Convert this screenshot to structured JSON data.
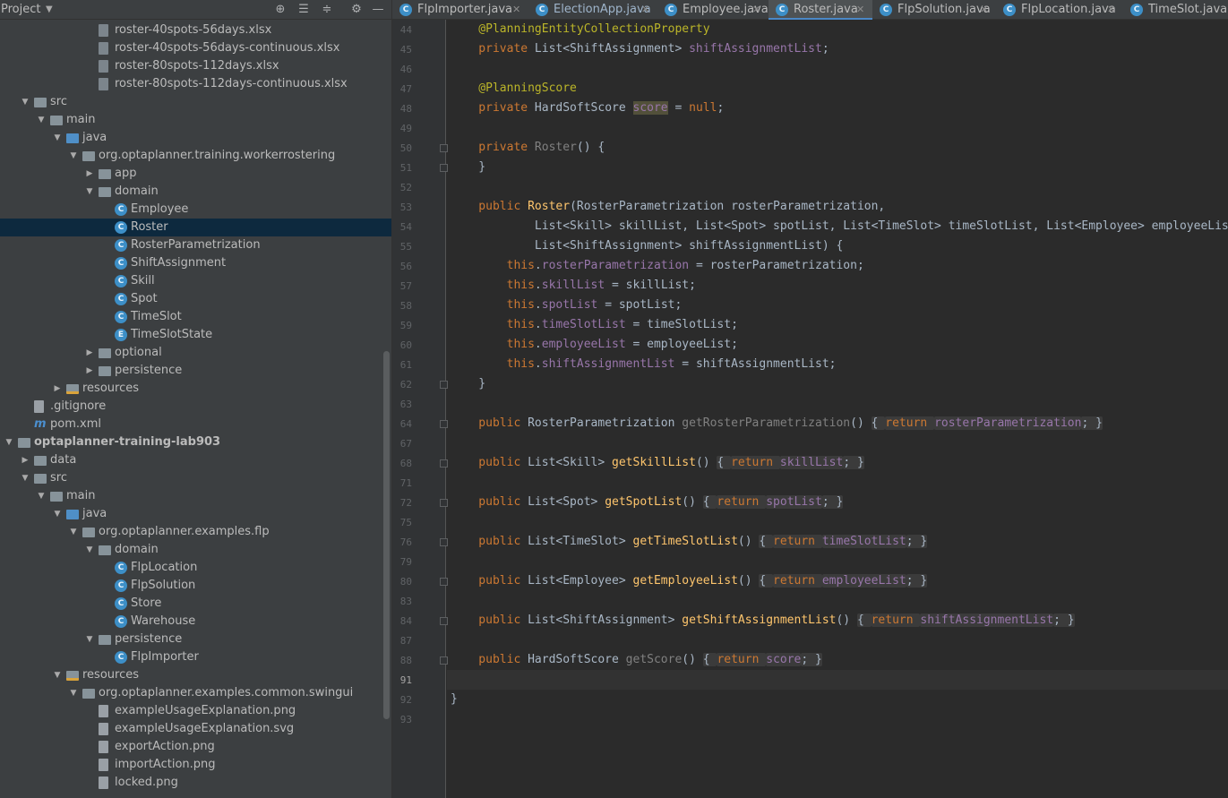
{
  "project_panel": {
    "title": "Project",
    "toolbar_icons": [
      "locate-icon",
      "expand-all-icon",
      "collapse-all-icon",
      "settings-icon",
      "hide-icon"
    ]
  },
  "tree": [
    {
      "label": "roster-40spots-56days.xlsx",
      "icon": "xlsx-file-icon",
      "depth": 5,
      "arrow": ""
    },
    {
      "label": "roster-40spots-56days-continuous.xlsx",
      "icon": "xlsx-file-icon",
      "depth": 5,
      "arrow": ""
    },
    {
      "label": "roster-80spots-112days.xlsx",
      "icon": "xlsx-file-icon",
      "depth": 5,
      "arrow": ""
    },
    {
      "label": "roster-80spots-112days-continuous.xlsx",
      "icon": "xlsx-file-icon",
      "depth": 5,
      "arrow": ""
    },
    {
      "label": "src",
      "icon": "folder-icon",
      "depth": 1,
      "arrow": "down"
    },
    {
      "label": "main",
      "icon": "folder-icon",
      "depth": 2,
      "arrow": "down"
    },
    {
      "label": "java",
      "icon": "source-folder-icon",
      "depth": 3,
      "arrow": "down"
    },
    {
      "label": "org.optaplanner.training.workerrostering",
      "icon": "package-icon",
      "depth": 4,
      "arrow": "down"
    },
    {
      "label": "app",
      "icon": "package-icon",
      "depth": 5,
      "arrow": "right"
    },
    {
      "label": "domain",
      "icon": "package-icon",
      "depth": 5,
      "arrow": "down"
    },
    {
      "label": "Employee",
      "icon": "class-icon",
      "depth": 6,
      "arrow": ""
    },
    {
      "label": "Roster",
      "icon": "class-icon",
      "depth": 6,
      "arrow": "",
      "selected": true
    },
    {
      "label": "RosterParametrization",
      "icon": "class-icon",
      "depth": 6,
      "arrow": ""
    },
    {
      "label": "ShiftAssignment",
      "icon": "class-icon",
      "depth": 6,
      "arrow": ""
    },
    {
      "label": "Skill",
      "icon": "class-icon",
      "depth": 6,
      "arrow": ""
    },
    {
      "label": "Spot",
      "icon": "class-icon",
      "depth": 6,
      "arrow": ""
    },
    {
      "label": "TimeSlot",
      "icon": "class-icon",
      "depth": 6,
      "arrow": ""
    },
    {
      "label": "TimeSlotState",
      "icon": "enum-icon",
      "depth": 6,
      "arrow": ""
    },
    {
      "label": "optional",
      "icon": "package-icon",
      "depth": 5,
      "arrow": "right"
    },
    {
      "label": "persistence",
      "icon": "package-icon",
      "depth": 5,
      "arrow": "right"
    },
    {
      "label": "resources",
      "icon": "resources-folder-icon",
      "depth": 3,
      "arrow": "right"
    },
    {
      "label": ".gitignore",
      "icon": "gitignore-file-icon",
      "depth": 1,
      "arrow": ""
    },
    {
      "label": "pom.xml",
      "icon": "maven-icon",
      "depth": 1,
      "arrow": ""
    },
    {
      "label": "optaplanner-training-lab903",
      "icon": "module-icon",
      "depth": 0,
      "arrow": "down",
      "bold": true
    },
    {
      "label": "data",
      "icon": "folder-icon",
      "depth": 1,
      "arrow": "right"
    },
    {
      "label": "src",
      "icon": "folder-icon",
      "depth": 1,
      "arrow": "down"
    },
    {
      "label": "main",
      "icon": "folder-icon",
      "depth": 2,
      "arrow": "down"
    },
    {
      "label": "java",
      "icon": "source-folder-icon",
      "depth": 3,
      "arrow": "down"
    },
    {
      "label": "org.optaplanner.examples.flp",
      "icon": "package-icon",
      "depth": 4,
      "arrow": "down"
    },
    {
      "label": "domain",
      "icon": "package-icon",
      "depth": 5,
      "arrow": "down"
    },
    {
      "label": "FlpLocation",
      "icon": "class-icon",
      "depth": 6,
      "arrow": ""
    },
    {
      "label": "FlpSolution",
      "icon": "class-icon",
      "depth": 6,
      "arrow": ""
    },
    {
      "label": "Store",
      "icon": "class-icon",
      "depth": 6,
      "arrow": ""
    },
    {
      "label": "Warehouse",
      "icon": "class-icon",
      "depth": 6,
      "arrow": ""
    },
    {
      "label": "persistence",
      "icon": "package-icon",
      "depth": 5,
      "arrow": "down"
    },
    {
      "label": "FlpImporter",
      "icon": "class-icon",
      "depth": 6,
      "arrow": ""
    },
    {
      "label": "resources",
      "icon": "resources-folder-icon",
      "depth": 3,
      "arrow": "down"
    },
    {
      "label": "org.optaplanner.examples.common.swingui",
      "icon": "package-icon",
      "depth": 4,
      "arrow": "down"
    },
    {
      "label": "exampleUsageExplanation.png",
      "icon": "image-file-icon",
      "depth": 5,
      "arrow": ""
    },
    {
      "label": "exampleUsageExplanation.svg",
      "icon": "image-file-icon",
      "depth": 5,
      "arrow": ""
    },
    {
      "label": "exportAction.png",
      "icon": "image-file-icon",
      "depth": 5,
      "arrow": ""
    },
    {
      "label": "importAction.png",
      "icon": "image-file-icon",
      "depth": 5,
      "arrow": ""
    },
    {
      "label": "locked.png",
      "icon": "image-file-icon",
      "depth": 5,
      "arrow": ""
    }
  ],
  "tabs": [
    {
      "label": "FlpImporter.java",
      "active": false,
      "main": false
    },
    {
      "label": "ElectionApp.java",
      "active": false,
      "main": true
    },
    {
      "label": "Employee.java",
      "active": false,
      "main": false
    },
    {
      "label": "Roster.java",
      "active": true,
      "main": false
    },
    {
      "label": "FlpSolution.java",
      "active": false,
      "main": false
    },
    {
      "label": "FlpLocation.java",
      "active": false,
      "main": false
    },
    {
      "label": "TimeSlot.java",
      "active": false,
      "main": false
    }
  ],
  "editor": {
    "current_line": "91",
    "lines": [
      {
        "n": "44",
        "fold": false,
        "tokens": [
          [
            "an",
            "    @PlanningEntityCollectionProperty"
          ]
        ]
      },
      {
        "n": "45",
        "fold": false,
        "tokens": [
          [
            "kw",
            "    private "
          ],
          [
            "",
            "List<ShiftAssignment> "
          ],
          [
            "fd",
            "shiftAssignmentList"
          ],
          [
            "",
            ";"
          ]
        ]
      },
      {
        "n": "46",
        "fold": false,
        "tokens": []
      },
      {
        "n": "47",
        "fold": false,
        "tokens": [
          [
            "an",
            "    @PlanningScore"
          ]
        ]
      },
      {
        "n": "48",
        "fold": false,
        "tokens": [
          [
            "kw",
            "    private "
          ],
          [
            "",
            "HardSoftScore "
          ],
          [
            "fd hl",
            "score"
          ],
          [
            "",
            " = "
          ],
          [
            "kw",
            "null"
          ],
          [
            "",
            ";"
          ]
        ]
      },
      {
        "n": "49",
        "fold": false,
        "tokens": []
      },
      {
        "n": "50",
        "fold": true,
        "tokens": [
          [
            "kw",
            "    private "
          ],
          [
            "gr",
            "Roster"
          ],
          [
            "",
            "() {"
          ]
        ]
      },
      {
        "n": "51",
        "fold": true,
        "tokens": [
          [
            "",
            "    }"
          ]
        ]
      },
      {
        "n": "52",
        "fold": false,
        "tokens": []
      },
      {
        "n": "53",
        "fold": false,
        "tokens": [
          [
            "kw",
            "    public "
          ],
          [
            "mt",
            "Roster"
          ],
          [
            "",
            "(RosterParametrization rosterParametrization,"
          ]
        ]
      },
      {
        "n": "54",
        "fold": false,
        "tokens": [
          [
            "",
            "            List<Skill> skillList, List<Spot> spotList, List<TimeSlot> timeSlotList, List<Employee> employeeList,"
          ]
        ]
      },
      {
        "n": "55",
        "fold": false,
        "tokens": [
          [
            "",
            "            List<ShiftAssignment> shiftAssignmentList) {"
          ]
        ]
      },
      {
        "n": "56",
        "fold": false,
        "tokens": [
          [
            "kw",
            "        this"
          ],
          [
            "",
            "."
          ],
          [
            "fd",
            "rosterParametrization"
          ],
          [
            "",
            " = rosterParametrization;"
          ]
        ]
      },
      {
        "n": "57",
        "fold": false,
        "tokens": [
          [
            "kw",
            "        this"
          ],
          [
            "",
            "."
          ],
          [
            "fd",
            "skillList"
          ],
          [
            "",
            " = skillList;"
          ]
        ]
      },
      {
        "n": "58",
        "fold": false,
        "tokens": [
          [
            "kw",
            "        this"
          ],
          [
            "",
            "."
          ],
          [
            "fd",
            "spotList"
          ],
          [
            "",
            " = spotList;"
          ]
        ]
      },
      {
        "n": "59",
        "fold": false,
        "tokens": [
          [
            "kw",
            "        this"
          ],
          [
            "",
            "."
          ],
          [
            "fd",
            "timeSlotList"
          ],
          [
            "",
            " = timeSlotList;"
          ]
        ]
      },
      {
        "n": "60",
        "fold": false,
        "tokens": [
          [
            "kw",
            "        this"
          ],
          [
            "",
            "."
          ],
          [
            "fd",
            "employeeList"
          ],
          [
            "",
            " = employeeList;"
          ]
        ]
      },
      {
        "n": "61",
        "fold": false,
        "tokens": [
          [
            "kw",
            "        this"
          ],
          [
            "",
            "."
          ],
          [
            "fd",
            "shiftAssignmentList"
          ],
          [
            "",
            " = shiftAssignmentList;"
          ]
        ]
      },
      {
        "n": "62",
        "fold": true,
        "tokens": [
          [
            "",
            "    }"
          ]
        ]
      },
      {
        "n": "63",
        "fold": false,
        "tokens": []
      },
      {
        "n": "64",
        "fold": true,
        "tokens": [
          [
            "kw",
            "    public "
          ],
          [
            "",
            "RosterParametrization "
          ],
          [
            "gr",
            "getRosterParametrization"
          ],
          [
            "",
            "() "
          ],
          [
            "inlay",
            "{ "
          ],
          [
            "kw inlay",
            "return "
          ],
          [
            "fd inlay",
            "rosterParametrization"
          ],
          [
            "inlay",
            "; }"
          ]
        ]
      },
      {
        "n": "67",
        "fold": false,
        "tokens": []
      },
      {
        "n": "68",
        "fold": true,
        "tokens": [
          [
            "kw",
            "    public "
          ],
          [
            "",
            "List<Skill> "
          ],
          [
            "mt",
            "getSkillList"
          ],
          [
            "",
            "() "
          ],
          [
            "inlay",
            "{ "
          ],
          [
            "kw inlay",
            "return "
          ],
          [
            "fd inlay",
            "skillList"
          ],
          [
            "inlay",
            "; }"
          ]
        ]
      },
      {
        "n": "71",
        "fold": false,
        "tokens": []
      },
      {
        "n": "72",
        "fold": true,
        "tokens": [
          [
            "kw",
            "    public "
          ],
          [
            "",
            "List<Spot> "
          ],
          [
            "mt",
            "getSpotList"
          ],
          [
            "",
            "() "
          ],
          [
            "inlay",
            "{ "
          ],
          [
            "kw inlay",
            "return "
          ],
          [
            "fd inlay",
            "spotList"
          ],
          [
            "inlay",
            "; }"
          ]
        ]
      },
      {
        "n": "75",
        "fold": false,
        "tokens": []
      },
      {
        "n": "76",
        "fold": true,
        "tokens": [
          [
            "kw",
            "    public "
          ],
          [
            "",
            "List<TimeSlot> "
          ],
          [
            "mt",
            "getTimeSlotList"
          ],
          [
            "",
            "() "
          ],
          [
            "inlay",
            "{ "
          ],
          [
            "kw inlay",
            "return "
          ],
          [
            "fd inlay",
            "timeSlotList"
          ],
          [
            "inlay",
            "; }"
          ]
        ]
      },
      {
        "n": "79",
        "fold": false,
        "tokens": []
      },
      {
        "n": "80",
        "fold": true,
        "tokens": [
          [
            "kw",
            "    public "
          ],
          [
            "",
            "List<Employee> "
          ],
          [
            "mt",
            "getEmployeeList"
          ],
          [
            "",
            "() "
          ],
          [
            "inlay",
            "{ "
          ],
          [
            "kw inlay",
            "return "
          ],
          [
            "fd inlay",
            "employeeList"
          ],
          [
            "inlay",
            "; }"
          ]
        ]
      },
      {
        "n": "83",
        "fold": false,
        "tokens": []
      },
      {
        "n": "84",
        "fold": true,
        "tokens": [
          [
            "kw",
            "    public "
          ],
          [
            "",
            "List<ShiftAssignment> "
          ],
          [
            "mt",
            "getShiftAssignmentList"
          ],
          [
            "",
            "() "
          ],
          [
            "inlay",
            "{ "
          ],
          [
            "kw inlay",
            "return "
          ],
          [
            "fd inlay",
            "shiftAssignmentList"
          ],
          [
            "inlay",
            "; }"
          ]
        ]
      },
      {
        "n": "87",
        "fold": false,
        "tokens": []
      },
      {
        "n": "88",
        "fold": true,
        "tokens": [
          [
            "kw",
            "    public "
          ],
          [
            "",
            "HardSoftScore "
          ],
          [
            "gr",
            "getScore"
          ],
          [
            "",
            "() "
          ],
          [
            "inlay",
            "{ "
          ],
          [
            "kw inlay",
            "return "
          ],
          [
            "fd inlay",
            "score"
          ],
          [
            "inlay",
            "; }"
          ]
        ]
      },
      {
        "n": "91",
        "fold": false,
        "tokens": []
      },
      {
        "n": "92",
        "fold": false,
        "tokens": [
          [
            "",
            "}"
          ]
        ]
      },
      {
        "n": "93",
        "fold": false,
        "tokens": []
      }
    ]
  }
}
